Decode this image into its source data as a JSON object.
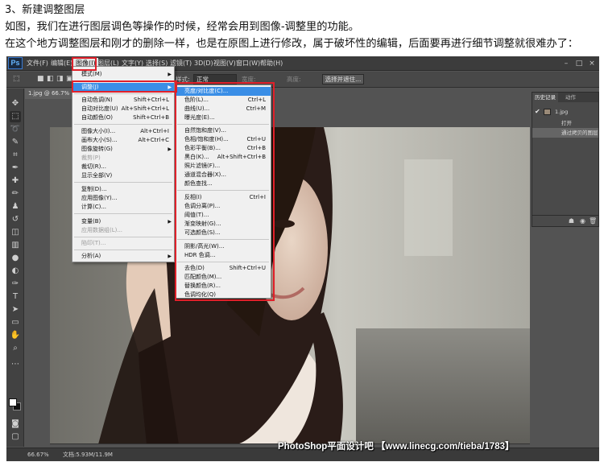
{
  "article": {
    "line1": "3、新建调整图层",
    "line2": "如图，我们在进行图层调色等操作的时候，经常会用到图像-调整里的功能。",
    "line3": "在这个地方调整图层和刚才的删除一样，也是在原图上进行修改，属于破坏性的编辑，后面要再进行细节调整就很难办了："
  },
  "app": {
    "logo": "Ps",
    "menubar": [
      "文件(F)",
      "编辑(E)",
      "图像(I)",
      "图层(L)",
      "文字(Y)",
      "选择(S)",
      "滤镜(T)",
      "3D(D)",
      "视图(V)",
      "窗口(W)",
      "帮助(H)"
    ],
    "window_controls": [
      "–",
      "□",
      "×"
    ]
  },
  "options": {
    "style_label": "样式:",
    "style_value": "正常",
    "width_label": "宽度:",
    "height_label": "高度:",
    "refine_button": "选择并遮住..."
  },
  "document": {
    "tab": "1.jpg @ 66.7% (图层 1..."
  },
  "image_menu": {
    "items": [
      {
        "label": "模式(M)",
        "shortcut": "",
        "submenu": true,
        "disabled": false
      },
      {
        "label": "调整(J)",
        "shortcut": "",
        "submenu": true,
        "disabled": false
      },
      {
        "label": "自动色调(N)",
        "shortcut": "Shift+Ctrl+L",
        "submenu": false,
        "disabled": false
      },
      {
        "label": "自动对比度(U)",
        "shortcut": "Alt+Shift+Ctrl+L",
        "submenu": false,
        "disabled": false
      },
      {
        "label": "自动颜色(O)",
        "shortcut": "Shift+Ctrl+B",
        "submenu": false,
        "disabled": false
      },
      {
        "label": "图像大小(I)...",
        "shortcut": "Alt+Ctrl+I",
        "submenu": false,
        "disabled": false
      },
      {
        "label": "画布大小(S)...",
        "shortcut": "Alt+Ctrl+C",
        "submenu": false,
        "disabled": false
      },
      {
        "label": "图像旋转(G)",
        "shortcut": "",
        "submenu": true,
        "disabled": false
      },
      {
        "label": "裁剪(P)",
        "shortcut": "",
        "submenu": false,
        "disabled": true
      },
      {
        "label": "裁切(R)...",
        "shortcut": "",
        "submenu": false,
        "disabled": false
      },
      {
        "label": "显示全部(V)",
        "shortcut": "",
        "submenu": false,
        "disabled": false
      },
      {
        "label": "复制(D)...",
        "shortcut": "",
        "submenu": false,
        "disabled": false
      },
      {
        "label": "应用图像(Y)...",
        "shortcut": "",
        "submenu": false,
        "disabled": false
      },
      {
        "label": "计算(C)...",
        "shortcut": "",
        "submenu": false,
        "disabled": false
      },
      {
        "label": "变量(B)",
        "shortcut": "",
        "submenu": true,
        "disabled": false
      },
      {
        "label": "应用数据组(L)...",
        "shortcut": "",
        "submenu": false,
        "disabled": true
      },
      {
        "label": "陷印(T)...",
        "shortcut": "",
        "submenu": false,
        "disabled": true
      },
      {
        "label": "分析(A)",
        "shortcut": "",
        "submenu": true,
        "disabled": false
      }
    ]
  },
  "adjust_menu": {
    "items": [
      {
        "label": "亮度/对比度(C)...",
        "shortcut": ""
      },
      {
        "label": "色阶(L)...",
        "shortcut": "Ctrl+L"
      },
      {
        "label": "曲线(U)...",
        "shortcut": "Ctrl+M"
      },
      {
        "label": "曝光度(E)...",
        "shortcut": ""
      },
      {
        "label": "自然饱和度(V)...",
        "shortcut": ""
      },
      {
        "label": "色相/饱和度(H)...",
        "shortcut": "Ctrl+U"
      },
      {
        "label": "色彩平衡(B)...",
        "shortcut": "Ctrl+B"
      },
      {
        "label": "黑白(K)...",
        "shortcut": "Alt+Shift+Ctrl+B"
      },
      {
        "label": "照片滤镜(F)...",
        "shortcut": ""
      },
      {
        "label": "通道混合器(X)...",
        "shortcut": ""
      },
      {
        "label": "颜色查找...",
        "shortcut": ""
      },
      {
        "label": "反相(I)",
        "shortcut": "Ctrl+I"
      },
      {
        "label": "色调分离(P)...",
        "shortcut": ""
      },
      {
        "label": "阈值(T)...",
        "shortcut": ""
      },
      {
        "label": "渐变映射(G)...",
        "shortcut": ""
      },
      {
        "label": "可选颜色(S)...",
        "shortcut": ""
      },
      {
        "label": "阴影/高光(W)...",
        "shortcut": ""
      },
      {
        "label": "HDR 色调...",
        "shortcut": ""
      },
      {
        "label": "去色(D)",
        "shortcut": "Shift+Ctrl+U"
      },
      {
        "label": "匹配颜色(M)...",
        "shortcut": ""
      },
      {
        "label": "替换颜色(R)...",
        "shortcut": ""
      },
      {
        "label": "色调均化(Q)",
        "shortcut": ""
      }
    ]
  },
  "history": {
    "tabs": [
      "历史记录",
      "动作"
    ],
    "snapshot": "1.jpg",
    "items": [
      "打开",
      "通过拷贝的图层"
    ]
  },
  "status": {
    "zoom": "66.67%",
    "doc_size": "文档:5.93M/11.9M"
  },
  "watermark": "PhotoShop平面设计吧 【www.linecg.com/tieba/1783】",
  "colors": {
    "highlight": "#3a8ee6",
    "red_box": "#e0202a",
    "ps_ui": "#535353"
  }
}
